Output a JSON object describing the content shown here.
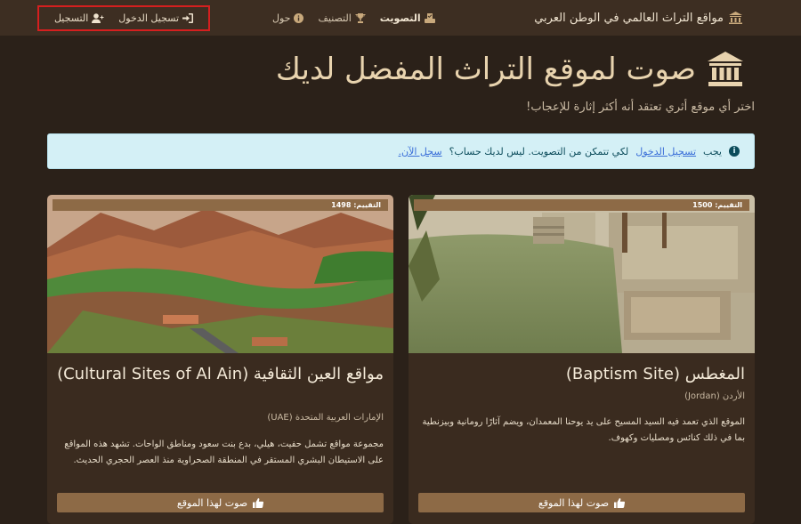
{
  "navbar": {
    "brand": "مواقع التراث العالمي في الوطن العربي",
    "links": [
      {
        "label": "التصويت",
        "icon": "ballot-icon"
      },
      {
        "label": "التصنيف",
        "icon": "trophy-icon"
      },
      {
        "label": "حول",
        "icon": "info-icon"
      }
    ],
    "login": "تسجيل الدخول",
    "register": "التسجيل"
  },
  "hero": {
    "title": "صوت لموقع التراث المفضل لديك",
    "subtitle": "اختر أي موقع أثري تعتقد أنه أكثر إثارة للإعجاب!"
  },
  "alert": {
    "prefix": "يجب",
    "login_link": "تسجيل الدخول",
    "middle": "لكي تتمكن من التصويت. ليس لديك حساب؟",
    "register_link": "سجل الآن."
  },
  "cards": [
    {
      "rating": "التقييم: 1500",
      "title": "المغطس (Baptism Site)",
      "country": "الأردن (Jordan)",
      "description": "الموقع الذي تعمد فيه السيد المسيح على يد يوحنا المعمدان، ويضم آثارًا رومانية وبيزنطية بما في ذلك كنائس ومصليات وكهوف.",
      "vote": "صوت لهذا الموقع"
    },
    {
      "rating": "التقييم: 1498",
      "title": "مواقع العين الثقافية (Cultural Sites of Al Ain)",
      "country": "الإمارات العربية المتحدة (UAE)",
      "description": "مجموعة مواقع تشمل حفيت، هيلي، بدع بنت سعود ومناطق الواحات. تشهد هذه المواقع على الاستيطان البشري المستقر في المنطقة الصحراوية منذ العصر الحجري الحديث.",
      "vote": "صوت لهذا الموقع"
    }
  ]
}
